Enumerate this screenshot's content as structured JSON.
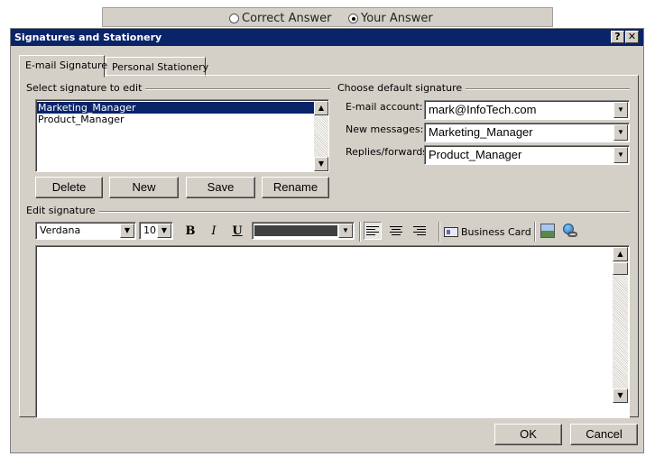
{
  "answer_toggle": {
    "correct_label": "Correct Answer",
    "your_label": "Your Answer",
    "selected": "your"
  },
  "dialog": {
    "title": "Signatures and Stationery",
    "help_button": "?",
    "close_button": "✕"
  },
  "tabs": [
    {
      "label": "E-mail Signature",
      "active": true
    },
    {
      "label": "Personal Stationery",
      "active": false
    }
  ],
  "select_signature": {
    "group_label": "Select signature to edit",
    "items": [
      "Marketing_Manager",
      "Product_Manager"
    ],
    "selected_index": 0,
    "buttons": {
      "delete": "Delete",
      "new": "New",
      "save": "Save",
      "rename": "Rename"
    }
  },
  "default_signature": {
    "group_label": "Choose default signature",
    "email_account_label": "E-mail account:",
    "email_account_value": "mark@InfoTech.com",
    "new_messages_label": "New messages:",
    "new_messages_value": "Marketing_Manager",
    "replies_label": "Replies/forwards:",
    "replies_value": "Product_Manager"
  },
  "edit_signature": {
    "group_label": "Edit signature",
    "font_name": "Verdana",
    "font_size": "10",
    "bold": "B",
    "italic": "I",
    "underline": "U",
    "business_card_label": "Business Card",
    "body_text": ""
  },
  "footer": {
    "ok": "OK",
    "cancel": "Cancel"
  },
  "colors": {
    "dialog_bg": "#d4d0c8",
    "title_bar": "#0a246a",
    "selection": "#0a246a",
    "color_picker": "#404040"
  }
}
